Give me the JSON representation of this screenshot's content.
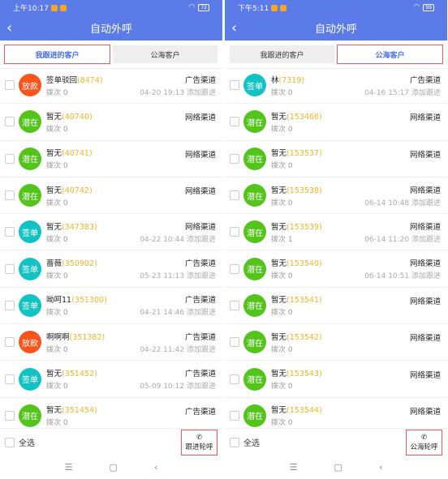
{
  "colors": {
    "header": "#5b7be8",
    "accent_tab": "#4a6fe0",
    "highlight": "#e85a5a",
    "id": "#f0b429",
    "potential": "#52c41a",
    "signed": "#13c2c2",
    "loan": "#fa541c"
  },
  "screens": [
    {
      "status": {
        "time": "上午10:17",
        "battery": "72"
      },
      "title": "自动外呼",
      "tabs": [
        {
          "label": "我跟进的客户",
          "active": true
        },
        {
          "label": "公海客户",
          "active": false
        }
      ],
      "rows": [
        {
          "tag": "放款",
          "tagType": "loan",
          "name": "签单驳回",
          "id": "(8474)",
          "calls": "拨次 0",
          "channel": "广告渠道",
          "time": "04-20 19:13 添加跟进"
        },
        {
          "tag": "潜在",
          "tagType": "potential",
          "name": "暂无",
          "id": "(40740)",
          "calls": "拨次 0",
          "channel": "网络渠道",
          "time": ""
        },
        {
          "tag": "潜在",
          "tagType": "potential",
          "name": "暂无",
          "id": "(40741)",
          "calls": "拨次 0",
          "channel": "网络渠道",
          "time": ""
        },
        {
          "tag": "潜在",
          "tagType": "potential",
          "name": "暂无",
          "id": "(40742)",
          "calls": "拨次 0",
          "channel": "网络渠道",
          "time": ""
        },
        {
          "tag": "签单",
          "tagType": "signed",
          "name": "暂无",
          "id": "(347383)",
          "calls": "拨次 0",
          "channel": "网络渠道",
          "time": "04-22 10:44 添加跟进"
        },
        {
          "tag": "签单",
          "tagType": "signed",
          "name": "蔷薇",
          "id": "(350902)",
          "calls": "拨次 0",
          "channel": "广告渠道",
          "time": "05-23 11:13 添加跟进"
        },
        {
          "tag": "签单",
          "tagType": "signed",
          "name": "呦呵11",
          "id": "(351300)",
          "calls": "拨次 0",
          "channel": "广告渠道",
          "time": "04-21 14:46 添加跟进"
        },
        {
          "tag": "放款",
          "tagType": "loan",
          "name": "啊啊啊",
          "id": "(351382)",
          "calls": "拨次 0",
          "channel": "广告渠道",
          "time": "04-22 11:42 添加跟进"
        },
        {
          "tag": "签单",
          "tagType": "signed",
          "name": "暂无",
          "id": "(351452)",
          "calls": "拨次 0",
          "channel": "广告渠道",
          "time": "05-09 10:12 添加跟进"
        },
        {
          "tag": "潜在",
          "tagType": "potential",
          "name": "暂无",
          "id": "(351454)",
          "calls": "拨次 0",
          "channel": "广告渠道",
          "time": ""
        }
      ],
      "select_all": "全选",
      "call_button": "跟进轮呼"
    },
    {
      "status": {
        "time": "下午5:11",
        "battery": "99"
      },
      "title": "自动外呼",
      "tabs": [
        {
          "label": "我跟进的客户",
          "active": false
        },
        {
          "label": "公海客户",
          "active": true
        }
      ],
      "rows": [
        {
          "tag": "签单",
          "tagType": "signed",
          "name": "林",
          "id": "(7319)",
          "calls": "拨次 0",
          "channel": "广告渠道",
          "time": "04-16 15:17 添加跟进"
        },
        {
          "tag": "潜在",
          "tagType": "potential",
          "name": "暂无",
          "id": "(153466)",
          "calls": "拨次 0",
          "channel": "网络渠道",
          "time": ""
        },
        {
          "tag": "潜在",
          "tagType": "potential",
          "name": "暂无",
          "id": "(153537)",
          "calls": "拨次 0",
          "channel": "网络渠道",
          "time": ""
        },
        {
          "tag": "潜在",
          "tagType": "potential",
          "name": "暂无",
          "id": "(153538)",
          "calls": "拨次 0",
          "channel": "网络渠道",
          "time": "06-14 10:48 添加跟进"
        },
        {
          "tag": "潜在",
          "tagType": "potential",
          "name": "暂无",
          "id": "(153539)",
          "calls": "拨次 1",
          "channel": "网络渠道",
          "time": "06-14 11:20 添加跟进"
        },
        {
          "tag": "潜在",
          "tagType": "potential",
          "name": "暂无",
          "id": "(153540)",
          "calls": "拨次 0",
          "channel": "网络渠道",
          "time": "06-14 10:51 添加跟进"
        },
        {
          "tag": "潜在",
          "tagType": "potential",
          "name": "暂无",
          "id": "(153541)",
          "calls": "拨次 0",
          "channel": "网络渠道",
          "time": ""
        },
        {
          "tag": "潜在",
          "tagType": "potential",
          "name": "暂无",
          "id": "(153542)",
          "calls": "拨次 0",
          "channel": "网络渠道",
          "time": ""
        },
        {
          "tag": "潜在",
          "tagType": "potential",
          "name": "暂无",
          "id": "(153543)",
          "calls": "拨次 0",
          "channel": "网络渠道",
          "time": ""
        },
        {
          "tag": "潜在",
          "tagType": "potential",
          "name": "暂无",
          "id": "(153544)",
          "calls": "拨次 0",
          "channel": "网络渠道",
          "time": ""
        }
      ],
      "select_all": "全选",
      "call_button": "公海轮呼"
    }
  ]
}
